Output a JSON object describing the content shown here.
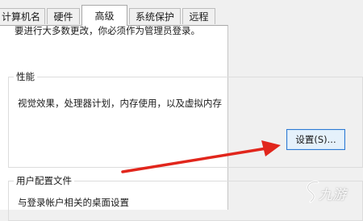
{
  "tabs": [
    {
      "label": "计算机名"
    },
    {
      "label": "硬件"
    },
    {
      "label": "高级"
    },
    {
      "label": "系统保护"
    },
    {
      "label": "远程"
    }
  ],
  "active_tab": "高级",
  "notice": "要进行大多数更改，你必须作为管理员登录。",
  "performance": {
    "title": "性能",
    "description": "视觉效果，处理器计划，内存使用，以及虚拟内存",
    "settings_button": "设置(S)..."
  },
  "user_profiles": {
    "title": "用户配置文件",
    "description": "与登录帐户相关的桌面设置"
  },
  "watermark": {
    "text": "九游"
  },
  "colors": {
    "arrow": "#e1261c",
    "button_border": "#2e7ad4",
    "button_fill": "#e5f1fb",
    "window_bg": "#f0f0f0",
    "panel_bg": "#ffffff"
  }
}
